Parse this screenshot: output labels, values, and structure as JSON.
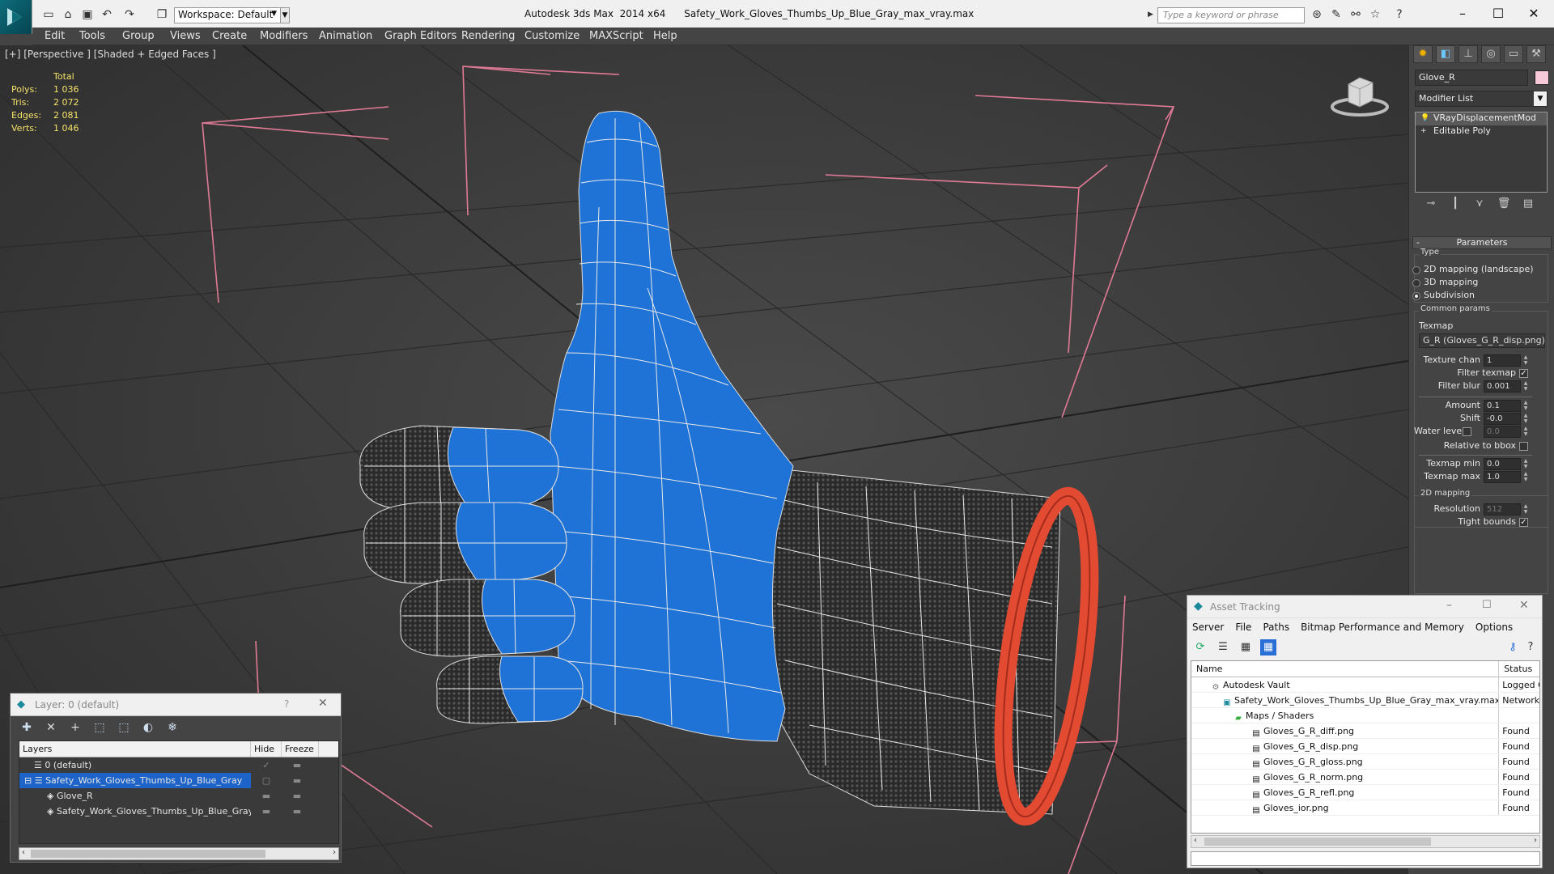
{
  "titlebar": {
    "workspace": "Workspace: Default",
    "window_title": "Autodesk 3ds Max  2014 x64      Safety_Work_Gloves_Thumbs_Up_Blue_Gray_max_vray.max",
    "search_placeholder": "Type a keyword or phrase"
  },
  "menu": [
    "Edit",
    "Tools",
    "Group",
    "Views",
    "Create",
    "Modifiers",
    "Animation",
    "Graph Editors",
    "Rendering",
    "Customize",
    "MAXScript",
    "Help"
  ],
  "viewport": {
    "label": "[+] [Perspective ] [Shaded + Edged Faces ]",
    "stats": {
      "header": "Total",
      "rows": [
        {
          "k": "Polys:",
          "v": "1 036"
        },
        {
          "k": "Tris:",
          "v": "2 072"
        },
        {
          "k": "Edges:",
          "v": "2 081"
        },
        {
          "k": "Verts:",
          "v": "1 046"
        }
      ]
    }
  },
  "command_panel": {
    "object_name": "Glove_R",
    "object_color": "#f5c9d8",
    "modifier_list": "Modifier List",
    "stack": [
      "VRayDisplacementMod",
      "Editable Poly"
    ],
    "parameters_title": "Parameters",
    "type_label": "Type",
    "type_options": [
      "2D mapping (landscape)",
      "3D mapping",
      "Subdivision"
    ],
    "common_params": "Common params",
    "texmap_label": "Texmap",
    "texmap_value": "G_R (Gloves_G_R_disp.png)",
    "texture_chan_label": "Texture chan",
    "texture_chan": "1",
    "filter_texmap_label": "Filter texmap",
    "filter_blur_label": "Filter blur",
    "filter_blur": "0.001",
    "amount_label": "Amount",
    "amount": "0.1",
    "shift_label": "Shift",
    "shift": "-0.0",
    "water_level_label": "Water level",
    "water_level": "0.0",
    "relative_bbox_label": "Relative to bbox",
    "texmap_min_label": "Texmap min",
    "texmap_min": "0.0",
    "texmap_max_label": "Texmap max",
    "texmap_max": "1.0",
    "mapping2d_label": "2D mapping",
    "resolution_label": "Resolution",
    "resolution": "512",
    "tight_bounds_label": "Tight bounds"
  },
  "layer_dialog": {
    "title": "Layer: 0 (default)",
    "columns": [
      "Layers",
      "Hide",
      "Freeze"
    ],
    "rows": [
      {
        "name": "0 (default)"
      },
      {
        "name": "Safety_Work_Gloves_Thumbs_Up_Blue_Gray"
      },
      {
        "name": "Glove_R"
      },
      {
        "name": "Safety_Work_Gloves_Thumbs_Up_Blue_Gray"
      }
    ]
  },
  "asset_tracking": {
    "title": "Asset Tracking",
    "menu": [
      "Server",
      "File",
      "Paths",
      "Bitmap Performance and Memory",
      "Options"
    ],
    "columns": [
      "Name",
      "Status"
    ],
    "rows": [
      {
        "name": "Autodesk Vault",
        "status": "Logged C"
      },
      {
        "name": "Safety_Work_Gloves_Thumbs_Up_Blue_Gray_max_vray.max",
        "status": "Network"
      },
      {
        "name": "Maps / Shaders",
        "status": ""
      },
      {
        "name": "Gloves_G_R_diff.png",
        "status": "Found"
      },
      {
        "name": "Gloves_G_R_disp.png",
        "status": "Found"
      },
      {
        "name": "Gloves_G_R_gloss.png",
        "status": "Found"
      },
      {
        "name": "Gloves_G_R_norm.png",
        "status": "Found"
      },
      {
        "name": "Gloves_G_R_refl.png",
        "status": "Found"
      },
      {
        "name": "Gloves_ior.png",
        "status": "Found"
      }
    ]
  }
}
